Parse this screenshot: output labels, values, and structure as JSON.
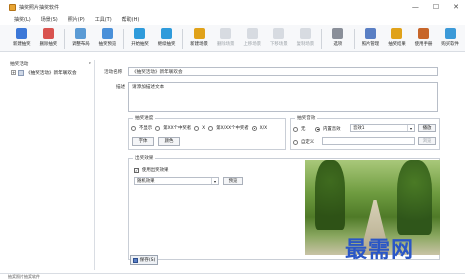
{
  "window": {
    "title": "抽奖照片抽奖软件",
    "minimize": "—",
    "maximize": "☐",
    "close": "✕"
  },
  "menu": [
    "抽奖(L)",
    "场景(S)",
    "照片(P)",
    "工具(T)",
    "帮助(H)"
  ],
  "toolbar": [
    {
      "label": "新建抽奖",
      "icon": "new-lottery-icon",
      "color": "#3c78d8",
      "enabled": true
    },
    {
      "label": "删除抽奖",
      "icon": "delete-lottery-icon",
      "color": "#d9534f",
      "enabled": true
    },
    {
      "label": "调整布局",
      "icon": "layout-icon",
      "color": "#5b9bd5",
      "enabled": true
    },
    {
      "label": "抽奖预览",
      "icon": "preview-icon",
      "color": "#4a90d9",
      "enabled": true
    },
    {
      "label": "开始抽奖",
      "icon": "start-icon",
      "color": "#2f9bdb",
      "enabled": true
    },
    {
      "label": "继续抽奖",
      "icon": "continue-icon",
      "color": "#2f9bdb",
      "enabled": true
    },
    {
      "label": "新建场景",
      "icon": "new-scene-icon",
      "color": "#e0a21a",
      "enabled": true
    },
    {
      "label": "删除场景",
      "icon": "delete-scene-icon",
      "color": "#b0b8c4",
      "enabled": false
    },
    {
      "label": "上移场景",
      "icon": "move-up-icon",
      "color": "#b0b8c4",
      "enabled": false
    },
    {
      "label": "下移场景",
      "icon": "move-down-icon",
      "color": "#b0b8c4",
      "enabled": false
    },
    {
      "label": "复制场景",
      "icon": "copy-scene-icon",
      "color": "#b0b8c4",
      "enabled": false
    },
    {
      "label": "选项",
      "icon": "options-icon",
      "color": "#8a8f99",
      "enabled": true
    },
    {
      "label": "照片管理",
      "icon": "photo-manage-icon",
      "color": "#5a7fc4",
      "enabled": true
    },
    {
      "label": "抽奖结果",
      "icon": "results-icon",
      "color": "#e0a21a",
      "enabled": true
    },
    {
      "label": "使用手册",
      "icon": "manual-icon",
      "color": "#c7662a",
      "enabled": true
    },
    {
      "label": "购买软件",
      "icon": "cart-icon",
      "color": "#3c9ad8",
      "enabled": true
    }
  ],
  "left_panel": {
    "title": "抽奖活动",
    "pin": "ᵖ",
    "tree_item": "《抽奖活动》新年联欢会",
    "toggle": "+"
  },
  "form": {
    "activity_label": "活动名称",
    "activity_value": "《抽奖活动》新年联欢会",
    "desc_label": "描述",
    "desc_value": "请添加描述文本",
    "progress_group": "抽奖进度",
    "progress_options": [
      "不显示",
      "第XX个中奖者",
      "X",
      "第X/XX个中奖者",
      "X/X"
    ],
    "progress_selected": 4,
    "font_btn": "字体",
    "color_btn": "颜色",
    "sound_group": "抽奖音效",
    "sound_none": "无",
    "sound_builtin": "内置音效",
    "sound_combo": "音效1",
    "sound_play_btn": "播放",
    "sound_custom": "自定义",
    "sound_browse_btn": "浏览",
    "sound_selected": "内置音效",
    "effect_group": "出奖效果",
    "effect_check_label": "使用出奖效果",
    "effect_checked": true,
    "effect_combo": "随机效果",
    "effect_preview_btn": "预览",
    "save_btn": "保存(S)"
  },
  "watermark": "最需网",
  "status": "抽奖照片抽奖软件"
}
